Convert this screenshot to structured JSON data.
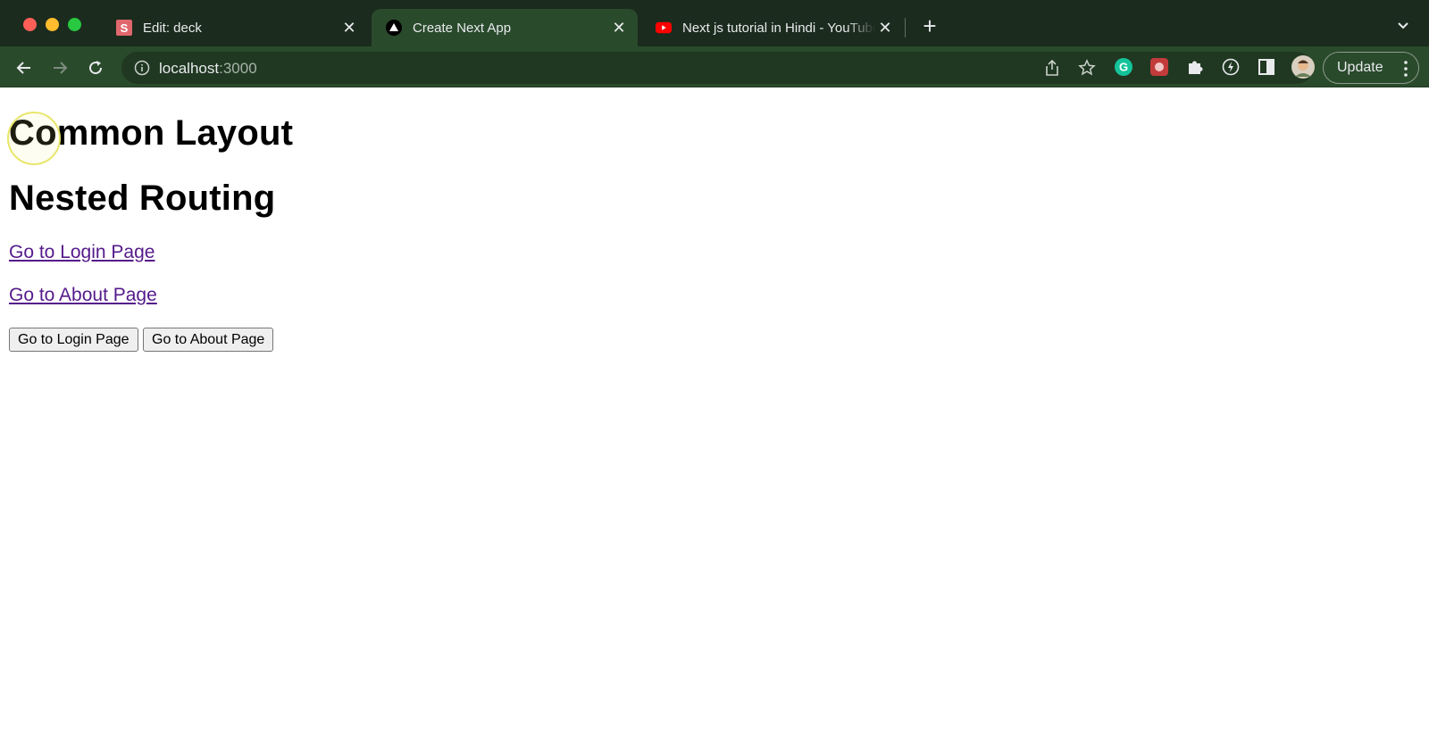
{
  "browser": {
    "tabs": [
      {
        "title": "Edit: deck",
        "favicon": "s-square-icon",
        "active": false
      },
      {
        "title": "Create Next App",
        "favicon": "nextjs-triangle-icon",
        "active": true
      },
      {
        "title": "Next js tutorial in Hindi - YouTube",
        "favicon": "youtube-icon",
        "active": false
      }
    ],
    "address": {
      "host": "localhost",
      "port": ":3000"
    },
    "update_label": "Update",
    "colors": {
      "frame": "#1b2b1e",
      "active_tab": "#2a4a2c",
      "youtube": "#ff0000"
    }
  },
  "page": {
    "heading_1": "Common Layout",
    "heading_2": "Nested Routing",
    "links": [
      "Go to Login Page",
      "Go to About Page"
    ],
    "buttons": [
      "Go to Login Page",
      "Go to About Page"
    ],
    "link_color": "#551a8b"
  }
}
